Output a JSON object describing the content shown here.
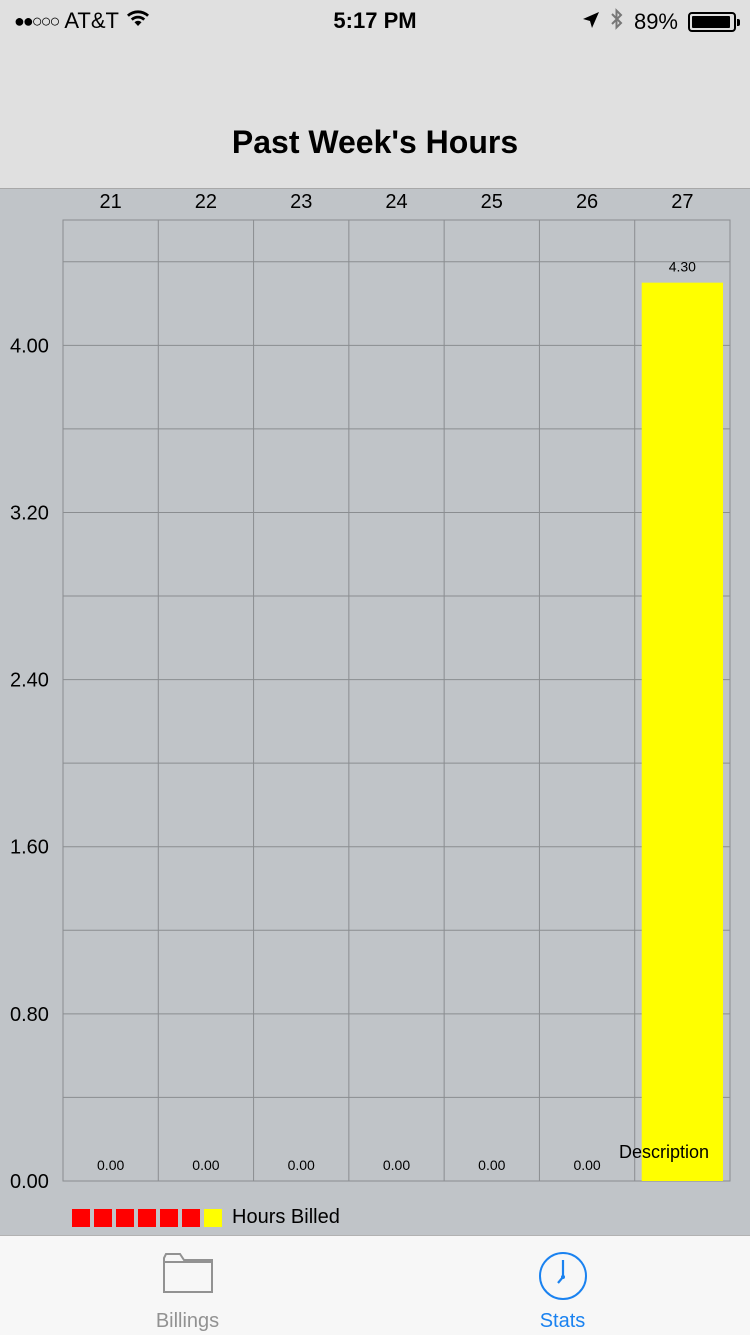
{
  "status": {
    "carrier": "AT&T",
    "signal_dots": "●●○○○",
    "time": "5:17 PM",
    "battery": "89%"
  },
  "nav": {
    "title": "Past Week's Hours"
  },
  "chart_data": {
    "type": "bar",
    "categories": [
      "21",
      "22",
      "23",
      "24",
      "25",
      "26",
      "27"
    ],
    "series": [
      {
        "name": "Hours Billed",
        "values": [
          0.0,
          0.0,
          0.0,
          0.0,
          0.0,
          0.0,
          4.3
        ],
        "value_labels": [
          "0.00",
          "0.00",
          "0.00",
          "0.00",
          "0.00",
          "0.00",
          "4.30"
        ],
        "colors": [
          "#ff0000",
          "#ff0000",
          "#ff0000",
          "#ff0000",
          "#ff0000",
          "#ff0000",
          "#ffff00"
        ]
      }
    ],
    "yticks": [
      "0.00",
      "0.80",
      "1.60",
      "2.40",
      "3.20",
      "4.00"
    ],
    "ylim": [
      0,
      4.6
    ],
    "grid": true,
    "description": "Description",
    "legend": {
      "position": "bottom-left",
      "label": "Hours Billed"
    }
  },
  "tabs": [
    {
      "label": "Billings",
      "icon": "folder-icon",
      "active": false,
      "color": "#929292"
    },
    {
      "label": "Stats",
      "icon": "clock-icon",
      "active": true,
      "color": "#1a82f0"
    }
  ]
}
